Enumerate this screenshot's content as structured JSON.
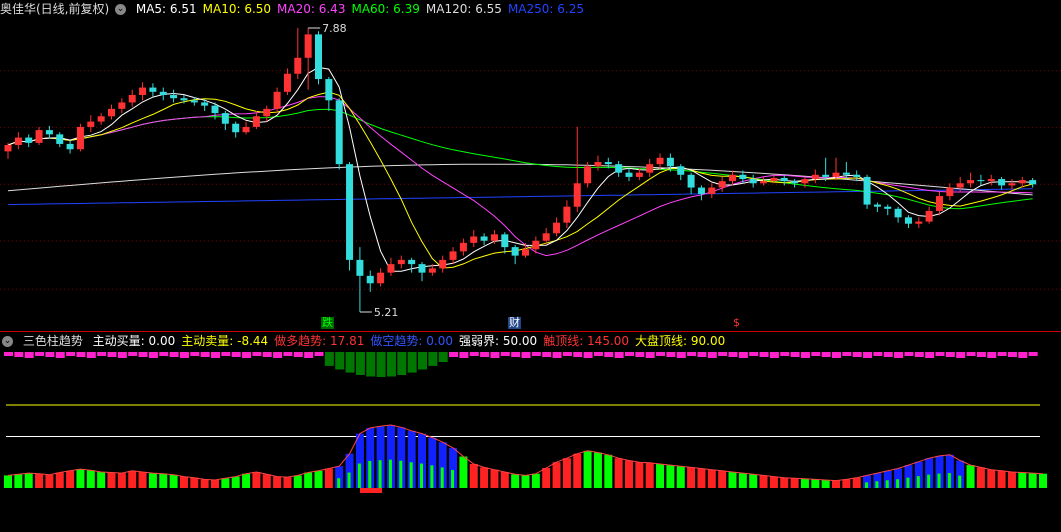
{
  "main_legend": {
    "title": "奥佳华(日线,前复权)",
    "items": [
      {
        "label": "MA5: 6.51",
        "color": "#ffffff"
      },
      {
        "label": "MA10: 6.50",
        "color": "#ffff00"
      },
      {
        "label": "MA20: 6.43",
        "color": "#ff44ff"
      },
      {
        "label": "MA60: 6.39",
        "color": "#00ff00"
      },
      {
        "label": "MA120: 6.55",
        "color": "#dddddd"
      },
      {
        "label": "MA250: 6.25",
        "color": "#2244ff"
      }
    ]
  },
  "price_labels": {
    "high": "7.88",
    "low": "5.21"
  },
  "signals": [
    {
      "text": "跌",
      "color": "#00ff00",
      "bg": "#006600"
    },
    {
      "text": "财",
      "color": "#ffffff",
      "bg": "#224488"
    },
    {
      "text": "$",
      "color": "#ff3333",
      "bg": "transparent"
    }
  ],
  "sub_legend": {
    "title": "三色柱趋势",
    "items": [
      {
        "label": "主动买量: 0.00",
        "color": "#ffffff"
      },
      {
        "label": "主动卖量: -8.44",
        "color": "#ffff00"
      },
      {
        "label": "做多趋势: 17.81",
        "color": "#ff3333"
      },
      {
        "label": "做空趋势: 0.00",
        "color": "#3355ff"
      },
      {
        "label": "强弱界: 50.00",
        "color": "#ffffff"
      },
      {
        "label": "触顶线: 145.00",
        "color": "#ff3333"
      },
      {
        "label": "大盘顶线: 90.00",
        "color": "#ffff00"
      }
    ]
  },
  "colors": {
    "up": "#ff3333",
    "down": "#33dddd",
    "divider": "#cc0000"
  },
  "chart_data": {
    "type": "candlestick",
    "candles": [
      [
        6.72,
        6.78,
        6.65,
        6.8
      ],
      [
        6.78,
        6.85,
        6.74,
        6.9
      ],
      [
        6.85,
        6.8,
        6.76,
        6.88
      ],
      [
        6.8,
        6.92,
        6.78,
        6.95
      ],
      [
        6.92,
        6.88,
        6.84,
        6.96
      ],
      [
        6.88,
        6.79,
        6.76,
        6.9
      ],
      [
        6.79,
        6.74,
        6.7,
        6.82
      ],
      [
        6.74,
        6.95,
        6.72,
        6.98
      ],
      [
        6.95,
        7.0,
        6.9,
        7.06
      ],
      [
        7.0,
        7.05,
        6.97,
        7.08
      ],
      [
        7.05,
        7.12,
        7.02,
        7.16
      ],
      [
        7.12,
        7.18,
        7.08,
        7.22
      ],
      [
        7.18,
        7.25,
        7.14,
        7.3
      ],
      [
        7.25,
        7.32,
        7.2,
        7.37
      ],
      [
        7.32,
        7.28,
        7.23,
        7.36
      ],
      [
        7.28,
        7.25,
        7.2,
        7.32
      ],
      [
        7.25,
        7.22,
        7.18,
        7.3
      ],
      [
        7.22,
        7.2,
        7.17,
        7.25
      ],
      [
        7.2,
        7.18,
        7.15,
        7.23
      ],
      [
        7.18,
        7.15,
        7.1,
        7.21
      ],
      [
        7.15,
        7.08,
        7.02,
        7.18
      ],
      [
        7.08,
        6.98,
        6.92,
        7.1
      ],
      [
        6.98,
        6.9,
        6.85,
        7.0
      ],
      [
        6.9,
        6.95,
        6.88,
        7.0
      ],
      [
        6.95,
        7.05,
        6.93,
        7.1
      ],
      [
        7.05,
        7.12,
        7.0,
        7.15
      ],
      [
        7.12,
        7.28,
        7.08,
        7.32
      ],
      [
        7.28,
        7.45,
        7.25,
        7.5
      ],
      [
        7.45,
        7.6,
        7.4,
        7.88
      ],
      [
        7.6,
        7.82,
        7.3,
        7.88
      ],
      [
        7.82,
        7.4,
        7.35,
        7.85
      ],
      [
        7.4,
        7.2,
        7.1,
        7.42
      ],
      [
        7.2,
        6.6,
        6.55,
        7.22
      ],
      [
        6.6,
        5.7,
        5.6,
        6.62
      ],
      [
        5.7,
        5.55,
        5.21,
        5.82
      ],
      [
        5.55,
        5.48,
        5.4,
        5.6
      ],
      [
        5.48,
        5.58,
        5.45,
        5.62
      ],
      [
        5.58,
        5.66,
        5.55,
        5.72
      ],
      [
        5.66,
        5.7,
        5.62,
        5.74
      ],
      [
        5.7,
        5.66,
        5.58,
        5.72
      ],
      [
        5.66,
        5.58,
        5.5,
        5.68
      ],
      [
        5.58,
        5.62,
        5.55,
        5.66
      ],
      [
        5.62,
        5.7,
        5.58,
        5.74
      ],
      [
        5.7,
        5.78,
        5.66,
        5.82
      ],
      [
        5.78,
        5.86,
        5.74,
        5.9
      ],
      [
        5.86,
        5.92,
        5.82,
        5.98
      ],
      [
        5.92,
        5.88,
        5.84,
        5.95
      ],
      [
        5.88,
        5.94,
        5.85,
        5.98
      ],
      [
        5.94,
        5.82,
        5.76,
        5.96
      ],
      [
        5.82,
        5.74,
        5.66,
        5.84
      ],
      [
        5.74,
        5.8,
        5.72,
        5.86
      ],
      [
        5.8,
        5.88,
        5.76,
        5.92
      ],
      [
        5.88,
        5.95,
        5.84,
        6.0
      ],
      [
        5.95,
        6.05,
        5.92,
        6.1
      ],
      [
        6.05,
        6.2,
        6.0,
        6.26
      ],
      [
        6.2,
        6.42,
        6.15,
        6.95
      ],
      [
        6.42,
        6.58,
        6.38,
        6.62
      ],
      [
        6.58,
        6.62,
        6.54,
        6.68
      ],
      [
        6.62,
        6.6,
        6.56,
        6.66
      ],
      [
        6.6,
        6.52,
        6.48,
        6.63
      ],
      [
        6.52,
        6.48,
        6.44,
        6.56
      ],
      [
        6.48,
        6.52,
        6.45,
        6.56
      ],
      [
        6.52,
        6.6,
        6.48,
        6.65
      ],
      [
        6.6,
        6.66,
        6.55,
        6.7
      ],
      [
        6.66,
        6.58,
        6.53,
        6.7
      ],
      [
        6.58,
        6.5,
        6.45,
        6.6
      ],
      [
        6.5,
        6.38,
        6.32,
        6.52
      ],
      [
        6.38,
        6.32,
        6.26,
        6.4
      ],
      [
        6.32,
        6.38,
        6.28,
        6.42
      ],
      [
        6.38,
        6.44,
        6.34,
        6.48
      ],
      [
        6.44,
        6.5,
        6.4,
        6.54
      ],
      [
        6.5,
        6.46,
        6.42,
        6.54
      ],
      [
        6.46,
        6.42,
        6.38,
        6.5
      ],
      [
        6.42,
        6.44,
        6.4,
        6.48
      ],
      [
        6.44,
        6.47,
        6.42,
        6.5
      ],
      [
        6.47,
        6.44,
        6.4,
        6.5
      ],
      [
        6.44,
        6.42,
        6.38,
        6.46
      ],
      [
        6.42,
        6.46,
        6.38,
        6.48
      ],
      [
        6.46,
        6.5,
        6.42,
        6.55
      ],
      [
        6.5,
        6.48,
        6.44,
        6.66
      ],
      [
        6.48,
        6.52,
        6.45,
        6.66
      ],
      [
        6.52,
        6.5,
        6.46,
        6.62
      ],
      [
        6.5,
        6.48,
        6.44,
        6.54
      ],
      [
        6.48,
        6.22,
        6.18,
        6.5
      ],
      [
        6.22,
        6.2,
        6.15,
        6.24
      ],
      [
        6.2,
        6.18,
        6.12,
        6.22
      ],
      [
        6.18,
        6.1,
        6.05,
        6.2
      ],
      [
        6.1,
        6.04,
        6.0,
        6.12
      ],
      [
        6.04,
        6.06,
        6.0,
        6.1
      ],
      [
        6.06,
        6.16,
        6.04,
        6.2
      ],
      [
        6.16,
        6.3,
        6.12,
        6.34
      ],
      [
        6.3,
        6.38,
        6.26,
        6.42
      ],
      [
        6.38,
        6.42,
        6.34,
        6.48
      ],
      [
        6.42,
        6.45,
        6.38,
        6.52
      ],
      [
        6.45,
        6.44,
        6.4,
        6.5
      ],
      [
        6.44,
        6.46,
        6.4,
        6.5
      ],
      [
        6.46,
        6.4,
        6.36,
        6.48
      ],
      [
        6.4,
        6.42,
        6.36,
        6.46
      ],
      [
        6.42,
        6.45,
        6.38,
        6.48
      ],
      [
        6.45,
        6.41,
        6.38,
        6.47
      ]
    ],
    "annotations": [
      {
        "text": "7.88"
      },
      {
        "text": "5.21"
      }
    ],
    "indicator": {
      "name": "三色柱趋势",
      "reference_lines": [
        {
          "label": "触顶线",
          "value": 145
        },
        {
          "label": "大盘顶线",
          "value": 90
        }
      ],
      "trend": [
        22,
        24,
        26,
        25,
        23,
        27,
        30,
        33,
        31,
        28,
        27,
        26,
        30,
        28,
        26,
        25,
        23,
        20,
        18,
        15,
        14,
        17,
        20,
        25,
        28,
        24,
        20,
        19,
        22,
        27,
        30,
        34,
        38,
        60,
        95,
        105,
        108,
        110,
        106,
        100,
        95,
        88,
        80,
        70,
        55,
        42,
        36,
        32,
        28,
        24,
        22,
        25,
        35,
        45,
        52,
        60,
        65,
        62,
        58,
        52,
        48,
        45,
        44,
        42,
        40,
        38,
        36,
        34,
        32,
        30,
        28,
        26,
        24,
        22,
        20,
        18,
        17,
        16,
        15,
        14,
        13,
        15,
        18,
        22,
        26,
        30,
        34,
        40,
        46,
        52,
        56,
        58,
        48,
        40,
        36,
        32,
        30,
        28,
        27,
        26,
        25
      ]
    }
  }
}
